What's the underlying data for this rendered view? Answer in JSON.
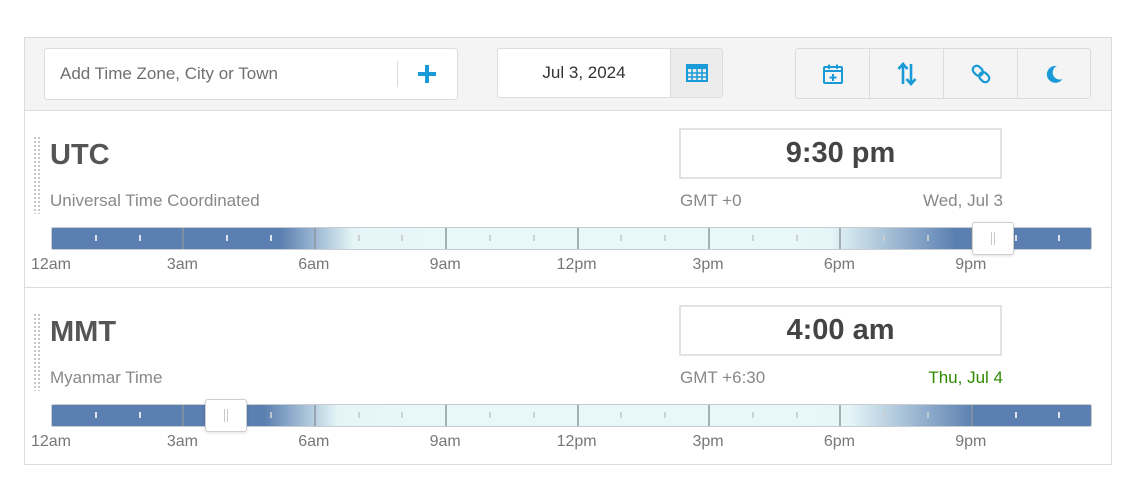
{
  "toolbar": {
    "search_placeholder": "Add Time Zone, City or Town",
    "add_icon": "plus-icon",
    "date": "Jul 3, 2024",
    "calendar_icon": "calendar-grid-icon",
    "buttons": [
      {
        "name": "add-event",
        "icon": "calendar-plus-icon"
      },
      {
        "name": "sort",
        "icon": "up-down-arrows-icon"
      },
      {
        "name": "link",
        "icon": "chain-link-icon"
      },
      {
        "name": "dark-mode",
        "icon": "crescent-moon-icon"
      }
    ]
  },
  "hour_labels": [
    "12am",
    "3am",
    "6am",
    "9am",
    "12pm",
    "3pm",
    "6pm",
    "9pm"
  ],
  "zones": [
    {
      "code": "UTC",
      "name": "Universal Time Coordinated",
      "time": "9:30 pm",
      "offset": "GMT +0",
      "day": "Wed, Jul 3",
      "slider_hour": 21.5
    },
    {
      "code": "MMT",
      "name": "Myanmar Time",
      "time": "4:00 am",
      "offset": "GMT +6:30",
      "day": "Thu, Jul 4",
      "slider_hour": 4.0
    }
  ],
  "colors": {
    "accent": "#1a9bd7",
    "night": "#5a7fb0",
    "day": "#e8f7f8",
    "next_day": "#2e8b00"
  }
}
